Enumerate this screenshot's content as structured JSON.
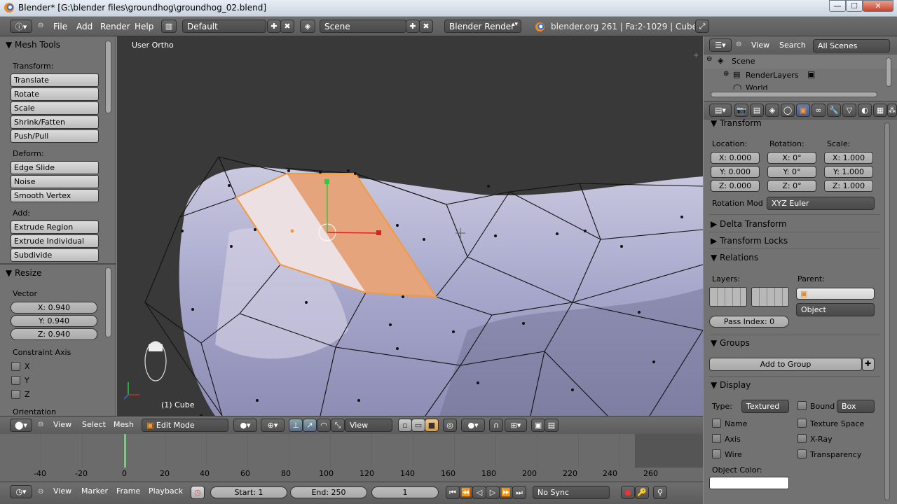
{
  "window": {
    "title": "Blender* [G:\\blender files\\groundhog\\groundhog_02.blend]",
    "min": "—",
    "max": "☐",
    "close": "✕"
  },
  "info": {
    "menus": [
      "File",
      "Add",
      "Render",
      "Help"
    ],
    "screen_layout": "Default",
    "scene": "Scene",
    "engine": "Blender Render",
    "stats": "blender.org 261 | Fa:2-1029 | Cube"
  },
  "toolshelf": {
    "title": "Mesh Tools",
    "transform_label": "Transform:",
    "transform": [
      "Translate",
      "Rotate",
      "Scale",
      "Shrink/Fatten",
      "Push/Pull"
    ],
    "deform_label": "Deform:",
    "deform": [
      "Edge Slide",
      "Noise",
      "Smooth Vertex"
    ],
    "add_label": "Add:",
    "add": [
      "Extrude Region",
      "Extrude Individual",
      "Subdivide"
    ],
    "resize_title": "Resize",
    "vector_label": "Vector",
    "vector": [
      "X: 0.940",
      "Y: 0.940",
      "Z: 0.940"
    ],
    "constraint_label": "Constraint Axis",
    "axes": [
      "X",
      "Y",
      "Z"
    ],
    "orientation_label": "Orientation"
  },
  "viewport": {
    "view_name": "User Ortho",
    "object_label": "(1) Cube"
  },
  "viewheader": {
    "menus": [
      "View",
      "Select",
      "Mesh"
    ],
    "mode": "Edit Mode",
    "transform_orient": "View"
  },
  "timeline": {
    "ruler": [
      "-40",
      "-20",
      "0",
      "20",
      "40",
      "60",
      "80",
      "100",
      "120",
      "140",
      "160",
      "180",
      "200",
      "220",
      "240",
      "260"
    ],
    "menus": [
      "View",
      "Marker",
      "Frame",
      "Playback"
    ],
    "start": "Start: 1",
    "end": "End: 250",
    "current": "1",
    "sync": "No Sync"
  },
  "outliner": {
    "menus": [
      "View",
      "Search"
    ],
    "filter": "All Scenes",
    "items": [
      "Scene",
      "RenderLayers",
      "World"
    ]
  },
  "properties": {
    "transform_title": "Transform",
    "location_label": "Location:",
    "rotation_label": "Rotation:",
    "scale_label": "Scale:",
    "location": [
      "X: 0.000",
      "Y: 0.000",
      "Z: 0.000"
    ],
    "rotation": [
      "X: 0°",
      "Y: 0°",
      "Z: 0°"
    ],
    "scale": [
      "X: 1.000",
      "Y: 1.000",
      "Z: 1.000"
    ],
    "rotation_mode_label": "Rotation Mod",
    "rotation_mode": "XYZ Euler",
    "delta": "Delta Transform",
    "locks": "Transform Locks",
    "relations": "Relations",
    "layers_label": "Layers:",
    "parent_label": "Parent:",
    "parent_type": "Object",
    "pass_index": "Pass Index: 0",
    "groups": "Groups",
    "add_group": "Add to Group",
    "display": "Display",
    "type_label": "Type:",
    "type_value": "Textured",
    "bound": "Bound",
    "bound_value": "Box",
    "checks_left": [
      "Name",
      "Axis",
      "Wire"
    ],
    "checks_right": [
      "Texture Space",
      "X-Ray",
      "Transparency"
    ],
    "object_color": "Object Color:"
  }
}
